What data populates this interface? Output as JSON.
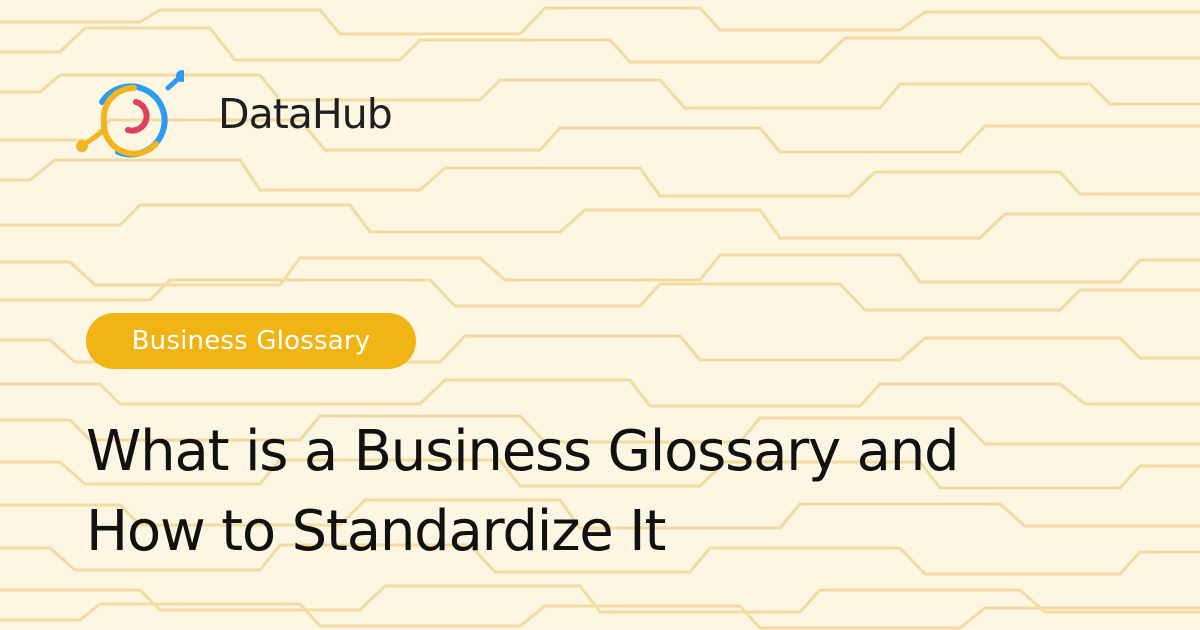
{
  "brand": {
    "name": "DataHub",
    "logo_icon": "datahub-logo-icon"
  },
  "tag": {
    "label": "Business Glossary"
  },
  "title": {
    "line1": "What is a Business Glossary and",
    "line2": "How to Standardize It"
  },
  "colors": {
    "background": "#fdf6e3",
    "pattern": "#f4dca0",
    "tag_background": "#f0b415",
    "logo_blue": "#2c9cf2",
    "logo_yellow": "#f3b422",
    "logo_red": "#e0405e"
  }
}
